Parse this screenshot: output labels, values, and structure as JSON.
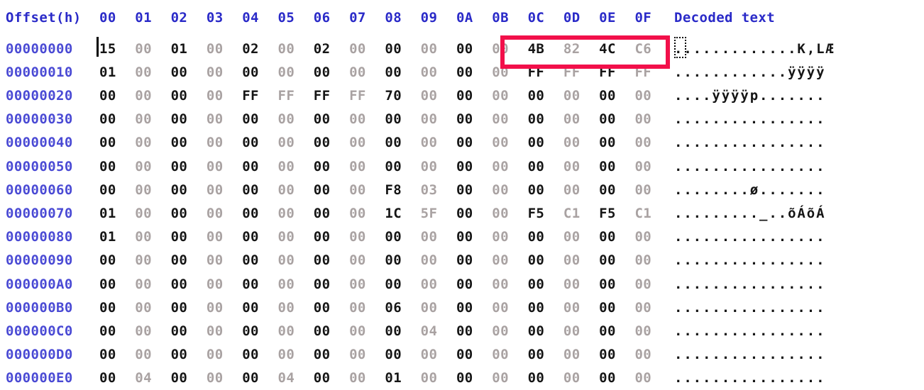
{
  "app": {
    "kind": "hex-editor",
    "view": "hex-dump"
  },
  "colors": {
    "header_text": "#2a2ac8",
    "offset_text": "#4a4ad4",
    "hex_even_column": "#151515",
    "hex_odd_column": "#a9a2a2",
    "decoded_text": "#151515",
    "highlight_box": "#f2104a",
    "background": "#ffffff"
  },
  "header": {
    "offset_label": "Offset(h)",
    "columns": [
      "00",
      "01",
      "02",
      "03",
      "04",
      "05",
      "06",
      "07",
      "08",
      "09",
      "0A",
      "0B",
      "0C",
      "0D",
      "0E",
      "0F"
    ],
    "decoded_label": "Decoded text"
  },
  "rows": [
    {
      "offset": "00000000",
      "bytes": [
        "15",
        "00",
        "01",
        "00",
        "02",
        "00",
        "02",
        "00",
        "00",
        "00",
        "00",
        "00",
        "4B",
        "82",
        "4C",
        "C6"
      ],
      "text": ".............K‚LÆ"
    },
    {
      "offset": "00000010",
      "bytes": [
        "01",
        "00",
        "00",
        "00",
        "00",
        "00",
        "00",
        "00",
        "00",
        "00",
        "00",
        "00",
        "FF",
        "FF",
        "FF",
        "FF"
      ],
      "text": "............ÿÿÿÿ"
    },
    {
      "offset": "00000020",
      "bytes": [
        "00",
        "00",
        "00",
        "00",
        "FF",
        "FF",
        "FF",
        "FF",
        "70",
        "00",
        "00",
        "00",
        "00",
        "00",
        "00",
        "00"
      ],
      "text": "....ÿÿÿÿp......."
    },
    {
      "offset": "00000030",
      "bytes": [
        "00",
        "00",
        "00",
        "00",
        "00",
        "00",
        "00",
        "00",
        "00",
        "00",
        "00",
        "00",
        "00",
        "00",
        "00",
        "00"
      ],
      "text": "................"
    },
    {
      "offset": "00000040",
      "bytes": [
        "00",
        "00",
        "00",
        "00",
        "00",
        "00",
        "00",
        "00",
        "00",
        "00",
        "00",
        "00",
        "00",
        "00",
        "00",
        "00"
      ],
      "text": "................"
    },
    {
      "offset": "00000050",
      "bytes": [
        "00",
        "00",
        "00",
        "00",
        "00",
        "00",
        "00",
        "00",
        "00",
        "00",
        "00",
        "00",
        "00",
        "00",
        "00",
        "00"
      ],
      "text": "................"
    },
    {
      "offset": "00000060",
      "bytes": [
        "00",
        "00",
        "00",
        "00",
        "00",
        "00",
        "00",
        "00",
        "F8",
        "03",
        "00",
        "00",
        "00",
        "00",
        "00",
        "00"
      ],
      "text": "........ø......."
    },
    {
      "offset": "00000070",
      "bytes": [
        "01",
        "00",
        "00",
        "00",
        "00",
        "00",
        "00",
        "00",
        "1C",
        "5F",
        "00",
        "00",
        "F5",
        "C1",
        "F5",
        "C1"
      ],
      "text": "........._..õÁõÁ"
    },
    {
      "offset": "00000080",
      "bytes": [
        "01",
        "00",
        "00",
        "00",
        "00",
        "00",
        "00",
        "00",
        "00",
        "00",
        "00",
        "00",
        "00",
        "00",
        "00",
        "00"
      ],
      "text": "................"
    },
    {
      "offset": "00000090",
      "bytes": [
        "00",
        "00",
        "00",
        "00",
        "00",
        "00",
        "00",
        "00",
        "00",
        "00",
        "00",
        "00",
        "00",
        "00",
        "00",
        "00"
      ],
      "text": "................"
    },
    {
      "offset": "000000A0",
      "bytes": [
        "00",
        "00",
        "00",
        "00",
        "00",
        "00",
        "00",
        "00",
        "00",
        "00",
        "00",
        "00",
        "00",
        "00",
        "00",
        "00"
      ],
      "text": "................"
    },
    {
      "offset": "000000B0",
      "bytes": [
        "00",
        "00",
        "00",
        "00",
        "00",
        "00",
        "00",
        "00",
        "06",
        "00",
        "00",
        "00",
        "00",
        "00",
        "00",
        "00"
      ],
      "text": "................"
    },
    {
      "offset": "000000C0",
      "bytes": [
        "00",
        "00",
        "00",
        "00",
        "00",
        "00",
        "00",
        "00",
        "00",
        "04",
        "00",
        "00",
        "00",
        "00",
        "00",
        "00"
      ],
      "text": "................"
    },
    {
      "offset": "000000D0",
      "bytes": [
        "00",
        "00",
        "00",
        "00",
        "00",
        "00",
        "00",
        "00",
        "00",
        "00",
        "00",
        "00",
        "00",
        "00",
        "00",
        "00"
      ],
      "text": "................"
    },
    {
      "offset": "000000E0",
      "bytes": [
        "00",
        "04",
        "00",
        "00",
        "00",
        "04",
        "00",
        "00",
        "01",
        "00",
        "00",
        "00",
        "00",
        "00",
        "00",
        "00"
      ],
      "text": "................"
    }
  ],
  "annotations": {
    "highlight_box": {
      "label": "red-rectangle-highlight",
      "covers_offset_row": "00000000",
      "covers_columns": [
        "0B",
        "0C",
        "0D",
        "0E",
        "0F"
      ],
      "covers_bytes": [
        "4B",
        "82",
        "4C",
        "C6"
      ],
      "color": "#f2104a"
    },
    "caret": {
      "label": "text-caret",
      "at_offset": "00000000",
      "at_column": "00"
    },
    "text_selection_marker": {
      "label": "decoded-text-cursor",
      "at_offset": "00000000",
      "at_column": "00"
    }
  }
}
